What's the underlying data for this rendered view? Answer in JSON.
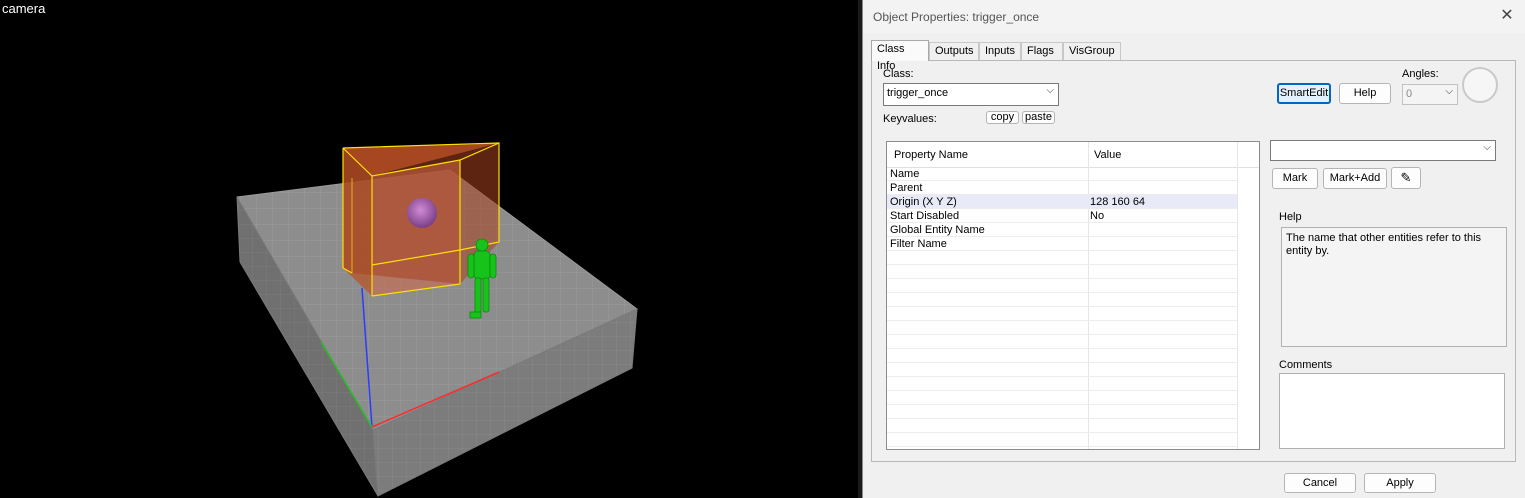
{
  "viewport": {
    "label": "camera"
  },
  "dialog": {
    "title": "Object Properties: trigger_once",
    "tabs": [
      "Class Info",
      "Outputs",
      "Inputs",
      "Flags",
      "VisGroup"
    ],
    "class_label": "Class:",
    "class_value": "trigger_once",
    "keyvalues_label": "Keyvalues:",
    "copy_label": "copy",
    "paste_label": "paste",
    "smartedit_label": "SmartEdit",
    "help_label": "Help",
    "angles_label": "Angles:",
    "angles_value": "0",
    "grid": {
      "col_property": "Property Name",
      "col_value": "Value",
      "rows": [
        {
          "name": "Name",
          "value": ""
        },
        {
          "name": "Parent",
          "value": ""
        },
        {
          "name": "Origin (X Y Z)",
          "value": "128 160 64"
        },
        {
          "name": "Start Disabled",
          "value": "No"
        },
        {
          "name": "Global Entity Name",
          "value": ""
        },
        {
          "name": "Filter Name",
          "value": ""
        }
      ]
    },
    "value_combo": "",
    "mark_label": "Mark",
    "markadd_label": "Mark+Add",
    "help_section_label": "Help",
    "help_text": "The name that other entities refer to this entity by.",
    "comments_label": "Comments",
    "comments_text": "",
    "cancel_label": "Cancel",
    "apply_label": "Apply"
  },
  "colors": {
    "trigger_face": "#b5552a",
    "trigger_edge": "#ffe000",
    "player": "#17c21a",
    "floor": "#8a8a8a",
    "accent": "#0067c0"
  }
}
